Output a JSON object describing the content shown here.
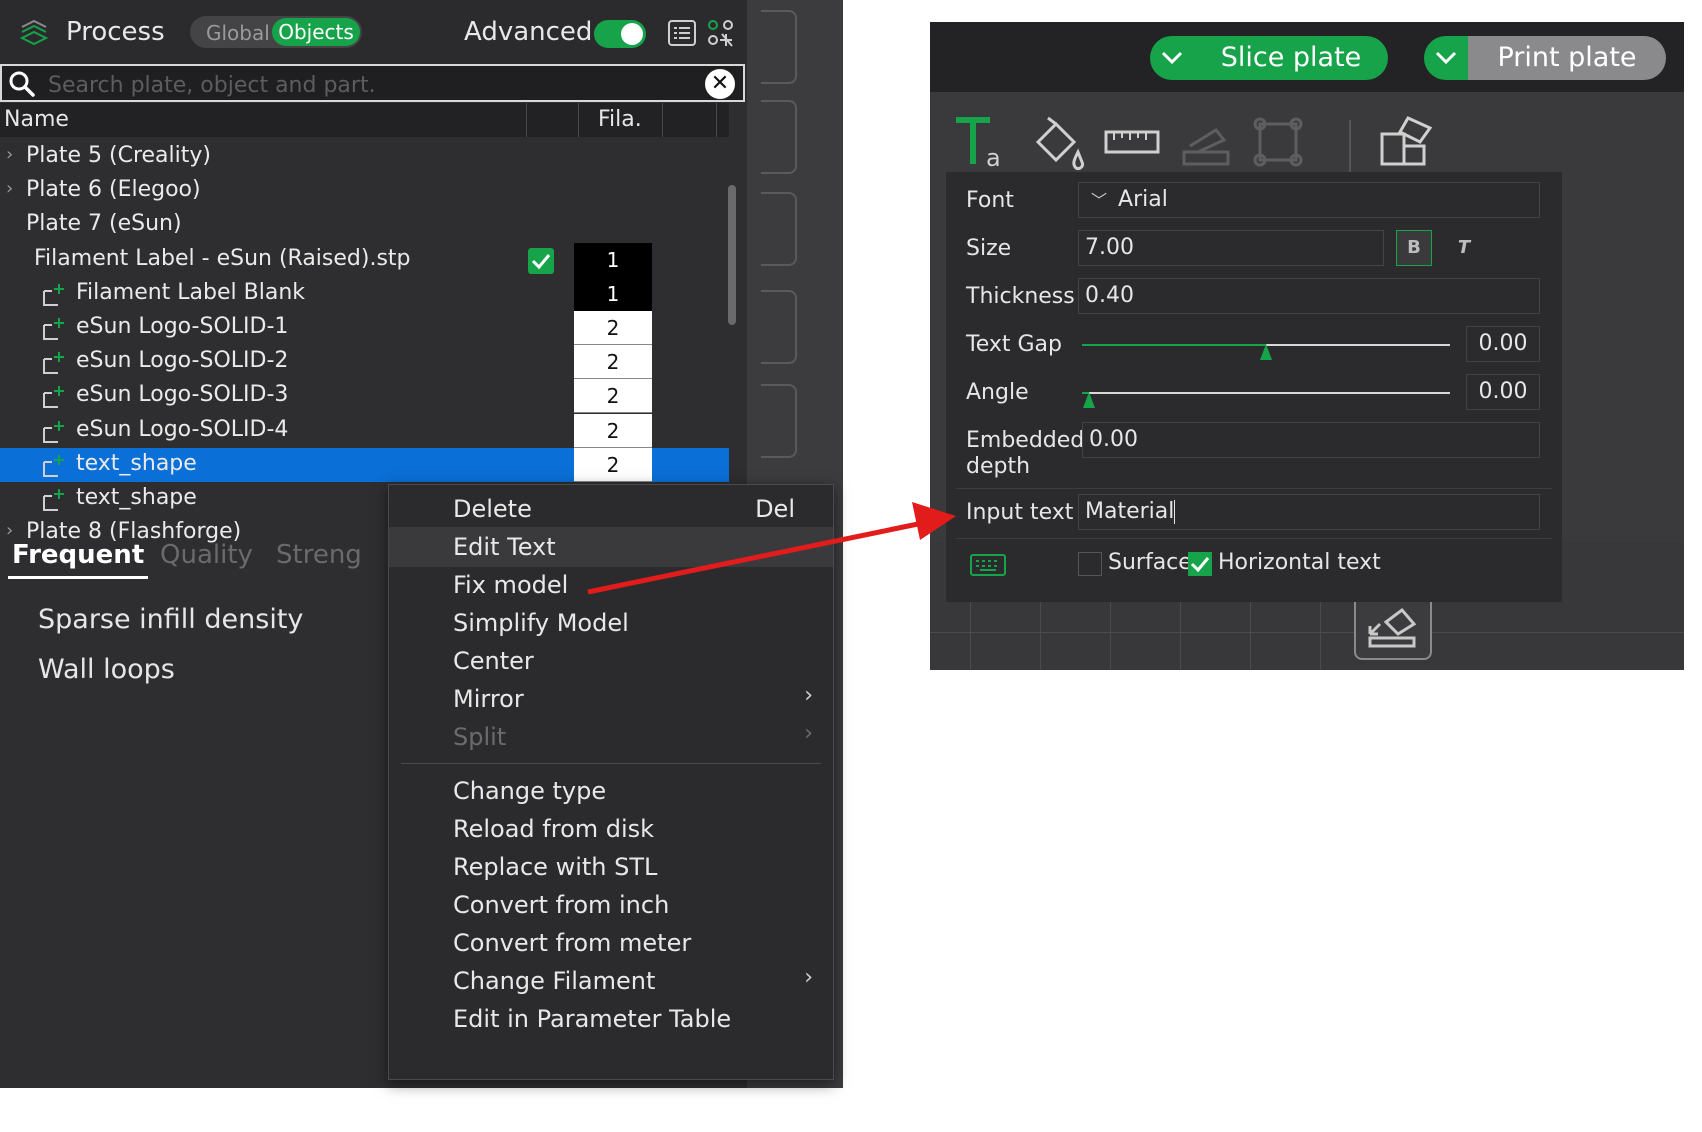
{
  "process_panel": {
    "title": "Process",
    "mode_global": "Global",
    "mode_objects": "Objects",
    "advanced_label": "Advanced",
    "advanced_on": true,
    "search_placeholder": "Search plate, object and part.",
    "columns": {
      "name": "Name",
      "fila": "Fila."
    },
    "tree": [
      {
        "label": "Plate 5 (Creality)",
        "type": "plate",
        "expanded": false
      },
      {
        "label": "Plate 6 (Elegoo)",
        "type": "plate",
        "expanded": false
      },
      {
        "label": "Plate 7 (eSun)",
        "type": "plate",
        "expanded": true
      },
      {
        "label": "Filament Label - eSun (Raised).stp",
        "type": "object",
        "fila": "1",
        "checked": true
      },
      {
        "label": "Filament Label Blank",
        "type": "part",
        "fila": "1"
      },
      {
        "label": "eSun Logo-SOLID-1",
        "type": "part",
        "fila": "2"
      },
      {
        "label": "eSun Logo-SOLID-2",
        "type": "part",
        "fila": "2"
      },
      {
        "label": "eSun Logo-SOLID-3",
        "type": "part",
        "fila": "2"
      },
      {
        "label": "eSun Logo-SOLID-4",
        "type": "part",
        "fila": "2"
      },
      {
        "label": "text_shape",
        "type": "part",
        "fila": "2",
        "selected": true
      },
      {
        "label": "text_shape",
        "type": "part"
      },
      {
        "label": "Plate 8 (Flashforge)",
        "type": "plate",
        "expanded": false
      }
    ],
    "tabs": [
      "Frequent",
      "Quality",
      "Streng"
    ],
    "active_tab": "Frequent",
    "settings": [
      "Sparse infill density",
      "Wall loops"
    ]
  },
  "context_menu": {
    "items": [
      {
        "label": "Delete",
        "shortcut": "Del"
      },
      {
        "label": "Edit Text",
        "hover": true
      },
      {
        "label": "Fix model"
      },
      {
        "label": "Simplify Model"
      },
      {
        "label": "Center"
      },
      {
        "label": "Mirror",
        "submenu": true
      },
      {
        "label": "Split",
        "submenu": true,
        "disabled": true
      },
      {
        "label": "Change type"
      },
      {
        "label": "Reload from disk"
      },
      {
        "label": "Replace with STL"
      },
      {
        "label": "Convert from inch"
      },
      {
        "label": "Convert from meter"
      },
      {
        "label": "Change Filament",
        "submenu": true
      },
      {
        "label": "Edit in Parameter Table"
      }
    ],
    "submenu_glyph": "›"
  },
  "right_panel": {
    "slice_label": "Slice plate",
    "print_label": "Print plate",
    "text_tool": {
      "font_label": "Font",
      "font_value": "Arial",
      "size_label": "Size",
      "size_value": "7.00",
      "bold_glyph": "B",
      "italic_glyph": "T",
      "thickness_label": "Thickness",
      "thickness_value": "0.40",
      "text_gap_label": "Text Gap",
      "text_gap_value": "0.00",
      "text_gap_level": 0.5,
      "angle_label": "Angle",
      "angle_value": "0.00",
      "angle_level": 0.02,
      "embedded_label_1": "Embedded",
      "embedded_label_2": "depth",
      "embedded_value": "0.00",
      "input_text_label": "Input text",
      "input_text_value": "Material",
      "surface_label": "Surface",
      "surface_checked": false,
      "horizontal_label": "Horizontal text",
      "horizontal_checked": true
    }
  },
  "colors": {
    "accent_green": "#16a34a",
    "selection_blue": "#0a6fd6",
    "arrow_red": "#e21b1b"
  }
}
